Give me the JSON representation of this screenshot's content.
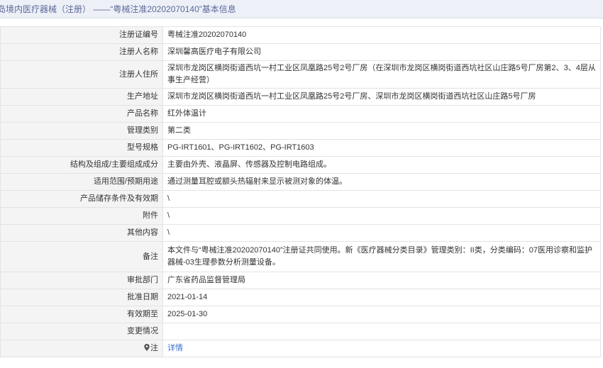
{
  "header": {
    "title": "岛境内医疗器械（注册） ——“粤械注准20202070140”基本信息"
  },
  "rows": [
    {
      "label": "注册证编号",
      "value": "粤械注准20202070140"
    },
    {
      "label": "注册人名称",
      "value": "深圳馨高医疗电子有限公司"
    },
    {
      "label": "注册人住所",
      "value": "深圳市龙岗区横岗街道西坑一村工业区凤凰路25号2号厂房（在深圳市龙岗区横岗街道西坑社区山庄路5号厂房第2、3、4层从事生产经营）"
    },
    {
      "label": "生产地址",
      "value": "深圳市龙岗区横岗街道西坑一村工业区凤凰路25号2号厂房、深圳市龙岗区横岗街道西坑社区山庄路5号厂房"
    },
    {
      "label": "产品名称",
      "value": "红外体温计"
    },
    {
      "label": "管理类别",
      "value": "第二类"
    },
    {
      "label": "型号规格",
      "value": "PG-IRT1601、PG-IRT1602、PG-IRT1603"
    },
    {
      "label": "结构及组成/主要组成成分",
      "value": "主要由外壳、液晶屏、传感器及控制电路组成。"
    },
    {
      "label": "适用范围/预期用途",
      "value": "通过测量耳腔或额头热辐射来显示被测对象的体温。"
    },
    {
      "label": "产品储存条件及有效期",
      "value": "\\"
    },
    {
      "label": "附件",
      "value": "\\"
    },
    {
      "label": "其他内容",
      "value": "\\"
    },
    {
      "label": "备注",
      "value": "本文件与“粤械注准20202070140”注册证共同使用。新《医疗器械分类目录》管理类别：II类，分类编码：07医用诊察和监护器械-03生理参数分析测量设备。"
    },
    {
      "label": "审批部门",
      "value": "广东省药品监督管理局"
    },
    {
      "label": "批准日期",
      "value": "2021-01-14"
    },
    {
      "label": "有效期至",
      "value": "2025-01-30"
    },
    {
      "label": "变更情况",
      "value": ""
    },
    {
      "label": "注",
      "value": "详情"
    }
  ]
}
